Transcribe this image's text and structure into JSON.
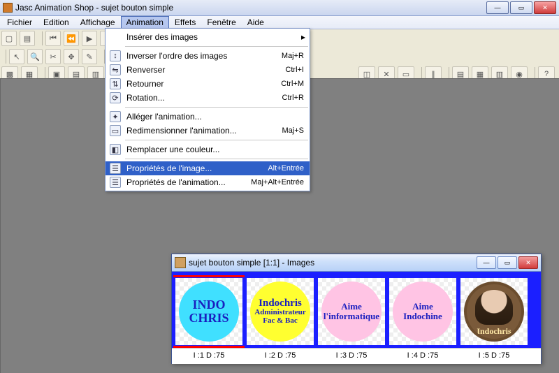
{
  "window": {
    "title": "Jasc Animation Shop - sujet bouton simple"
  },
  "menu": {
    "items": [
      "Fichier",
      "Edition",
      "Affichage",
      "Animation",
      "Effets",
      "Fenêtre",
      "Aide"
    ],
    "open_index": 3
  },
  "dropdown": {
    "rows": [
      {
        "label": "Insérer des images",
        "shortcut": "",
        "arrow": true,
        "icon": ""
      },
      {
        "sep": true
      },
      {
        "label": "Inverser l'ordre des images",
        "shortcut": "Maj+R",
        "arrow": false,
        "icon": "↕"
      },
      {
        "label": "Renverser",
        "shortcut": "Ctrl+I",
        "arrow": false,
        "icon": "⇋"
      },
      {
        "label": "Retourner",
        "shortcut": "Ctrl+M",
        "arrow": false,
        "icon": "⇅"
      },
      {
        "label": "Rotation...",
        "shortcut": "Ctrl+R",
        "arrow": false,
        "icon": "⟳"
      },
      {
        "sep": true
      },
      {
        "label": "Alléger l'animation...",
        "shortcut": "",
        "arrow": false,
        "icon": "✦"
      },
      {
        "label": "Redimensionner l'animation...",
        "shortcut": "Maj+S",
        "arrow": false,
        "icon": "▭"
      },
      {
        "sep": true
      },
      {
        "label": "Remplacer une couleur...",
        "shortcut": "",
        "arrow": false,
        "icon": "◧"
      },
      {
        "sep": true
      },
      {
        "label": "Propriétés de l'image...",
        "shortcut": "Alt+Entrée",
        "arrow": false,
        "icon": "☰",
        "hover": true
      },
      {
        "label": "Propriétés de l'animation...",
        "shortcut": "Maj+Alt+Entrée",
        "arrow": false,
        "icon": "☰"
      }
    ]
  },
  "child": {
    "title": "sujet bouton simple [1:1] - Images",
    "frames": [
      {
        "lines": [
          "INDO",
          "CHRIS"
        ],
        "style": "cyan",
        "label": "I :1   D :75",
        "selected": true
      },
      {
        "lines": [
          "Indochris",
          "Administrateur",
          "Fac & Bac"
        ],
        "style": "yellow",
        "label": "I :2   D :75"
      },
      {
        "lines": [
          "Aime",
          "l'informatique"
        ],
        "style": "pink",
        "label": "I :3   D :75"
      },
      {
        "lines": [
          "Aime",
          "Indochine"
        ],
        "style": "pink",
        "label": "I :4   D :75"
      },
      {
        "lines": [
          "Indochris"
        ],
        "style": "photo",
        "label": "I :5   D :75"
      }
    ]
  }
}
